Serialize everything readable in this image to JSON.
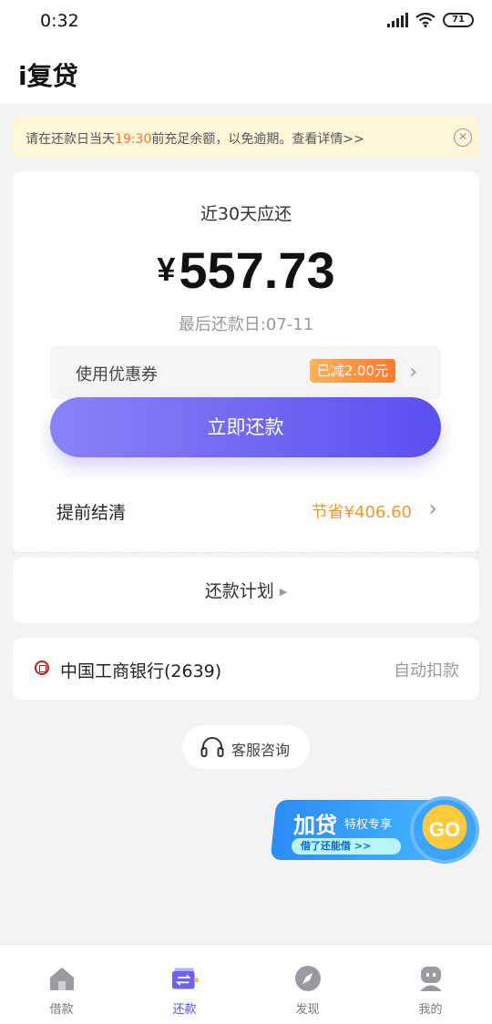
{
  "status_bar": {
    "time": "0:32",
    "battery": "71"
  },
  "header": {
    "title": "i复贷"
  },
  "notice": {
    "text_before": "请在还款日当天",
    "highlight": "19:30",
    "text_after": "前充足余额，以免逾期。查看详情>>"
  },
  "repayment": {
    "label": "近30天应还",
    "currency": "¥",
    "amount": "557.73",
    "due_date": "最后还款日:07-11"
  },
  "coupon": {
    "label": "使用优惠券",
    "badge": "已减2.00元"
  },
  "pay_button": {
    "label": "立即还款"
  },
  "early_settle": {
    "label": "提前结清",
    "saving": "节省¥406.60"
  },
  "plan": {
    "label": "还款计划"
  },
  "bank": {
    "name": "中国工商银行(2639)",
    "status": "自动扣款"
  },
  "service": {
    "label": "客服咨询"
  },
  "promo": {
    "title": "加贷",
    "subtitle": "特权专享",
    "pill": "借了还能借  >>",
    "go": "GO"
  },
  "tabs": [
    {
      "label": "借款",
      "icon": "home-icon",
      "active": false
    },
    {
      "label": "还款",
      "icon": "repay-icon",
      "active": true
    },
    {
      "label": "发现",
      "icon": "compass-icon",
      "active": false
    },
    {
      "label": "我的",
      "icon": "profile-icon",
      "active": false
    }
  ],
  "colors": {
    "accent": "#5b52f0",
    "highlight": "#f07a2a",
    "saving": "#f09a2a",
    "notice_bg": "#fff5d9"
  }
}
